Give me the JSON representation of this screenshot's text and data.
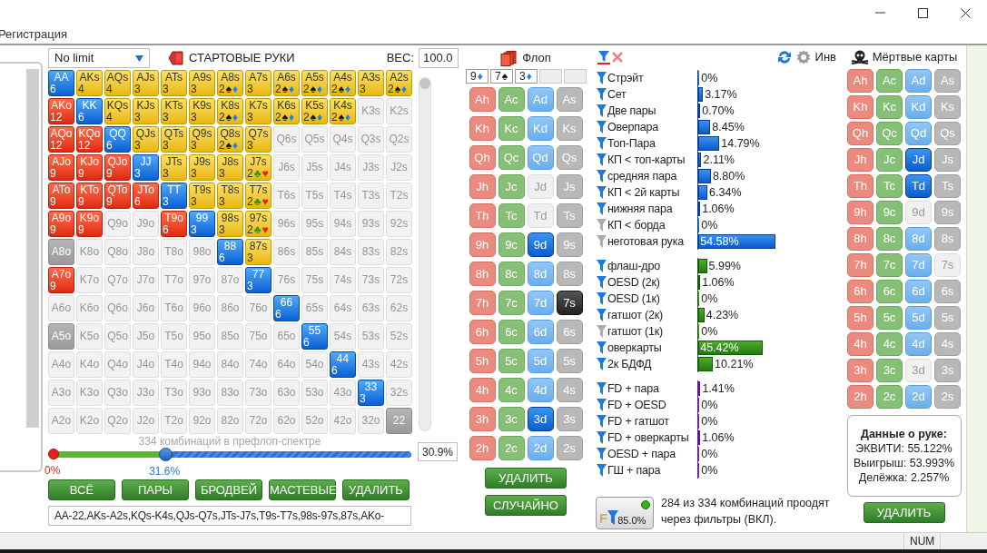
{
  "menu": [
    "Регистрация"
  ],
  "hand_range": {
    "game": "No limit",
    "title": "СТАРТОВЫЕ РУКИ",
    "weight_label": "ВЕС:",
    "weight": "100.0",
    "rows": [
      [
        {
          "label": "AA",
          "kind": "pair",
          "count": "6"
        },
        {
          "label": "AKs",
          "kind": "suited",
          "count": "4"
        },
        {
          "label": "AQs",
          "kind": "suited",
          "count": "4"
        },
        {
          "label": "AJs",
          "kind": "suited",
          "count": "3"
        },
        {
          "label": "ATs",
          "kind": "suited",
          "count": "3"
        },
        {
          "label": "A9s",
          "kind": "suited",
          "count": "3"
        },
        {
          "label": "A8s",
          "kind": "suited",
          "count": "2",
          "suits": [
            {
              "symbol": "♠",
              "color": "#111111"
            },
            {
              "symbol": "♦",
              "color": "#1784e8"
            }
          ]
        },
        {
          "label": "A7s",
          "kind": "suited",
          "count": "3"
        },
        {
          "label": "A6s",
          "kind": "suited",
          "count": "2",
          "suits": [
            {
              "symbol": "♠",
              "color": "#111111"
            },
            {
              "symbol": "♦",
              "color": "#1784e8"
            }
          ]
        },
        {
          "label": "A5s",
          "kind": "suited",
          "count": "2",
          "suits": [
            {
              "symbol": "♠",
              "color": "#111111"
            },
            {
              "symbol": "♦",
              "color": "#1784e8"
            }
          ]
        },
        {
          "label": "A4s",
          "kind": "suited",
          "count": "2",
          "suits": [
            {
              "symbol": "♠",
              "color": "#111111"
            },
            {
              "symbol": "♦",
              "color": "#1784e8"
            }
          ]
        },
        {
          "label": "A3s",
          "kind": "suited",
          "count": "3"
        },
        {
          "label": "A2s",
          "kind": "suited",
          "count": "2",
          "suits": [
            {
              "symbol": "♠",
              "color": "#111111"
            },
            {
              "symbol": "♦",
              "color": "#1784e8"
            }
          ]
        }
      ],
      [
        {
          "label": "AKo",
          "kind": "offsuit",
          "count": "12"
        },
        {
          "label": "KK",
          "kind": "pair",
          "count": "6"
        },
        {
          "label": "KQs",
          "kind": "suited",
          "count": "4"
        },
        {
          "label": "KJs",
          "kind": "suited",
          "count": "3"
        },
        {
          "label": "KTs",
          "kind": "suited",
          "count": "3"
        },
        {
          "label": "K9s",
          "kind": "suited",
          "count": "3"
        },
        {
          "label": "K8s",
          "kind": "suited",
          "count": "2",
          "suits": [
            {
              "symbol": "♠",
              "color": "#111111"
            },
            {
              "symbol": "♦",
              "color": "#1784e8"
            }
          ]
        },
        {
          "label": "K7s",
          "kind": "suited",
          "count": "3"
        },
        {
          "label": "K6s",
          "kind": "suited",
          "count": "2",
          "suits": [
            {
              "symbol": "♠",
              "color": "#111111"
            },
            {
              "symbol": "♦",
              "color": "#1784e8"
            }
          ]
        },
        {
          "label": "K5s",
          "kind": "suited",
          "count": "2",
          "suits": [
            {
              "symbol": "♠",
              "color": "#111111"
            },
            {
              "symbol": "♦",
              "color": "#1784e8"
            }
          ]
        },
        {
          "label": "K4s",
          "kind": "suited",
          "count": "2",
          "suits": [
            {
              "symbol": "♠",
              "color": "#111111"
            },
            {
              "symbol": "♦",
              "color": "#1784e8"
            }
          ]
        },
        {
          "label": "K3s",
          "kind": "empty"
        },
        {
          "label": "K2s",
          "kind": "empty"
        }
      ],
      [
        {
          "label": "AQo",
          "kind": "offsuit",
          "count": "12"
        },
        {
          "label": "KQo",
          "kind": "offsuit",
          "count": "12"
        },
        {
          "label": "QQ",
          "kind": "pair",
          "count": "6"
        },
        {
          "label": "QJs",
          "kind": "suited",
          "count": "3"
        },
        {
          "label": "QTs",
          "kind": "suited",
          "count": "3"
        },
        {
          "label": "Q9s",
          "kind": "suited",
          "count": "3"
        },
        {
          "label": "Q8s",
          "kind": "suited",
          "count": "2",
          "suits": [
            {
              "symbol": "♠",
              "color": "#111111"
            },
            {
              "symbol": "♦",
              "color": "#1784e8"
            }
          ]
        },
        {
          "label": "Q7s",
          "kind": "suited",
          "count": "3"
        },
        {
          "label": "Q6s",
          "kind": "empty"
        },
        {
          "label": "Q5s",
          "kind": "empty"
        },
        {
          "label": "Q4s",
          "kind": "empty"
        },
        {
          "label": "Q3s",
          "kind": "empty"
        },
        {
          "label": "Q2s",
          "kind": "empty"
        }
      ],
      [
        {
          "label": "AJo",
          "kind": "offsuit",
          "count": "9"
        },
        {
          "label": "KJo",
          "kind": "offsuit",
          "count": "9"
        },
        {
          "label": "QJo",
          "kind": "offsuit",
          "count": "9"
        },
        {
          "label": "JJ",
          "kind": "pair",
          "count": "3"
        },
        {
          "label": "JTs",
          "kind": "suited",
          "count": "3"
        },
        {
          "label": "J9s",
          "kind": "suited",
          "count": "3"
        },
        {
          "label": "J8s",
          "kind": "suited",
          "count": "3"
        },
        {
          "label": "J7s",
          "kind": "suited",
          "count": "2",
          "suits": [
            {
              "symbol": "♣",
              "color": "#2a9a1a"
            },
            {
              "symbol": "♥",
              "color": "#e8201a"
            }
          ]
        },
        {
          "label": "J6s",
          "kind": "empty"
        },
        {
          "label": "J5s",
          "kind": "empty"
        },
        {
          "label": "J4s",
          "kind": "empty"
        },
        {
          "label": "J3s",
          "kind": "empty"
        },
        {
          "label": "J2s",
          "kind": "empty"
        }
      ],
      [
        {
          "label": "ATo",
          "kind": "offsuit",
          "count": "9"
        },
        {
          "label": "KTo",
          "kind": "offsuit",
          "count": "9"
        },
        {
          "label": "QTo",
          "kind": "offsuit",
          "count": "9"
        },
        {
          "label": "JTo",
          "kind": "offsuit",
          "count": "6"
        },
        {
          "label": "TT",
          "kind": "pair",
          "count": "3"
        },
        {
          "label": "T9s",
          "kind": "suited",
          "count": "3"
        },
        {
          "label": "T8s",
          "kind": "suited",
          "count": "3"
        },
        {
          "label": "T7s",
          "kind": "suited",
          "count": "2",
          "suits": [
            {
              "symbol": "♣",
              "color": "#2a9a1a"
            },
            {
              "symbol": "♥",
              "color": "#e8201a"
            }
          ]
        },
        {
          "label": "T6s",
          "kind": "empty"
        },
        {
          "label": "T5s",
          "kind": "empty"
        },
        {
          "label": "T4s",
          "kind": "empty"
        },
        {
          "label": "T3s",
          "kind": "empty"
        },
        {
          "label": "T2s",
          "kind": "empty"
        }
      ],
      [
        {
          "label": "A9o",
          "kind": "offsuit",
          "count": "9"
        },
        {
          "label": "K9o",
          "kind": "offsuit",
          "count": "9"
        },
        {
          "label": "Q9o",
          "kind": "empty"
        },
        {
          "label": "J9o",
          "kind": "empty"
        },
        {
          "label": "T9o",
          "kind": "offsuit",
          "count": "6"
        },
        {
          "label": "99",
          "kind": "pair",
          "count": "3"
        },
        {
          "label": "98s",
          "kind": "suited",
          "count": "3"
        },
        {
          "label": "97s",
          "kind": "suited",
          "count": "2",
          "suits": [
            {
              "symbol": "♣",
              "color": "#2a9a1a"
            },
            {
              "symbol": "♥",
              "color": "#e8201a"
            }
          ]
        },
        {
          "label": "96s",
          "kind": "empty"
        },
        {
          "label": "95s",
          "kind": "empty"
        },
        {
          "label": "94s",
          "kind": "empty"
        },
        {
          "label": "93s",
          "kind": "empty"
        },
        {
          "label": "92s",
          "kind": "empty"
        }
      ],
      [
        {
          "label": "A8o",
          "kind": "muted"
        },
        {
          "label": "K8o",
          "kind": "empty"
        },
        {
          "label": "Q8o",
          "kind": "empty"
        },
        {
          "label": "J8o",
          "kind": "empty"
        },
        {
          "label": "T8o",
          "kind": "empty"
        },
        {
          "label": "98o",
          "kind": "empty"
        },
        {
          "label": "88",
          "kind": "pair",
          "count": "6"
        },
        {
          "label": "87s",
          "kind": "suited",
          "count": "3"
        },
        {
          "label": "86s",
          "kind": "empty"
        },
        {
          "label": "85s",
          "kind": "empty"
        },
        {
          "label": "84s",
          "kind": "empty"
        },
        {
          "label": "83s",
          "kind": "empty"
        },
        {
          "label": "82s",
          "kind": "empty"
        }
      ],
      [
        {
          "label": "A7o",
          "kind": "offsuit",
          "count": "9"
        },
        {
          "label": "K7o",
          "kind": "empty"
        },
        {
          "label": "Q7o",
          "kind": "empty"
        },
        {
          "label": "J7o",
          "kind": "empty"
        },
        {
          "label": "T7o",
          "kind": "empty"
        },
        {
          "label": "97o",
          "kind": "empty"
        },
        {
          "label": "87o",
          "kind": "empty"
        },
        {
          "label": "77",
          "kind": "pair",
          "count": "3"
        },
        {
          "label": "76s",
          "kind": "empty"
        },
        {
          "label": "75s",
          "kind": "empty"
        },
        {
          "label": "74s",
          "kind": "empty"
        },
        {
          "label": "73s",
          "kind": "empty"
        },
        {
          "label": "72s",
          "kind": "empty"
        }
      ],
      [
        {
          "label": "A6o",
          "kind": "empty"
        },
        {
          "label": "K6o",
          "kind": "empty"
        },
        {
          "label": "Q6o",
          "kind": "empty"
        },
        {
          "label": "J6o",
          "kind": "empty"
        },
        {
          "label": "T6o",
          "kind": "empty"
        },
        {
          "label": "96o",
          "kind": "empty"
        },
        {
          "label": "86o",
          "kind": "empty"
        },
        {
          "label": "76o",
          "kind": "empty"
        },
        {
          "label": "66",
          "kind": "pair",
          "count": "6"
        },
        {
          "label": "65s",
          "kind": "empty"
        },
        {
          "label": "64s",
          "kind": "empty"
        },
        {
          "label": "63s",
          "kind": "empty"
        },
        {
          "label": "62s",
          "kind": "empty"
        }
      ],
      [
        {
          "label": "A5o",
          "kind": "muted"
        },
        {
          "label": "K5o",
          "kind": "empty"
        },
        {
          "label": "Q5o",
          "kind": "empty"
        },
        {
          "label": "J5o",
          "kind": "empty"
        },
        {
          "label": "T5o",
          "kind": "empty"
        },
        {
          "label": "95o",
          "kind": "empty"
        },
        {
          "label": "85o",
          "kind": "empty"
        },
        {
          "label": "75o",
          "kind": "empty"
        },
        {
          "label": "65o",
          "kind": "empty"
        },
        {
          "label": "55",
          "kind": "pair",
          "count": "6"
        },
        {
          "label": "54s",
          "kind": "empty"
        },
        {
          "label": "53s",
          "kind": "empty"
        },
        {
          "label": "52s",
          "kind": "empty"
        }
      ],
      [
        {
          "label": "A4o",
          "kind": "empty"
        },
        {
          "label": "K4o",
          "kind": "empty"
        },
        {
          "label": "Q4o",
          "kind": "empty"
        },
        {
          "label": "J4o",
          "kind": "empty"
        },
        {
          "label": "T4o",
          "kind": "empty"
        },
        {
          "label": "94o",
          "kind": "empty"
        },
        {
          "label": "84o",
          "kind": "empty"
        },
        {
          "label": "74o",
          "kind": "empty"
        },
        {
          "label": "64o",
          "kind": "empty"
        },
        {
          "label": "54o",
          "kind": "empty"
        },
        {
          "label": "44",
          "kind": "pair",
          "count": "6"
        },
        {
          "label": "43s",
          "kind": "empty"
        },
        {
          "label": "42s",
          "kind": "empty"
        }
      ],
      [
        {
          "label": "A3o",
          "kind": "empty"
        },
        {
          "label": "K3o",
          "kind": "empty"
        },
        {
          "label": "Q3o",
          "kind": "empty"
        },
        {
          "label": "J3o",
          "kind": "empty"
        },
        {
          "label": "T3o",
          "kind": "empty"
        },
        {
          "label": "93o",
          "kind": "empty"
        },
        {
          "label": "83o",
          "kind": "empty"
        },
        {
          "label": "73o",
          "kind": "empty"
        },
        {
          "label": "63o",
          "kind": "empty"
        },
        {
          "label": "53o",
          "kind": "empty"
        },
        {
          "label": "43o",
          "kind": "empty"
        },
        {
          "label": "33",
          "kind": "pair",
          "count": "3"
        },
        {
          "label": "32s",
          "kind": "empty"
        }
      ],
      [
        {
          "label": "A2o",
          "kind": "empty"
        },
        {
          "label": "K2o",
          "kind": "empty"
        },
        {
          "label": "Q2o",
          "kind": "empty"
        },
        {
          "label": "J2o",
          "kind": "empty"
        },
        {
          "label": "T2o",
          "kind": "empty"
        },
        {
          "label": "92o",
          "kind": "empty"
        },
        {
          "label": "82o",
          "kind": "empty"
        },
        {
          "label": "72o",
          "kind": "empty"
        },
        {
          "label": "62o",
          "kind": "empty"
        },
        {
          "label": "52o",
          "kind": "empty"
        },
        {
          "label": "42o",
          "kind": "empty"
        },
        {
          "label": "32o",
          "kind": "empty"
        },
        {
          "label": "22",
          "kind": "muted"
        }
      ]
    ],
    "slider": {
      "caption": "334 комбинаций в префлоп-спектре",
      "min_label": "0%",
      "thumb_label": "31.6%",
      "level": 0.316,
      "percent": "30.9%"
    },
    "buttons": [
      "ВСЁ",
      "ПАРЫ",
      "БРОДВЕЙ",
      "МАСТЕВЫЕ",
      "УДАЛИТЬ"
    ],
    "range_text": "AA-22,AKs-A2s,KQs-K4s,QJs-Q7s,JTs-J7s,T9s-T7s,98s-97s,87s,AKo-"
  },
  "flop": {
    "title": "Флоп",
    "slots": [
      {
        "kind": "card",
        "rank": "9",
        "suit": "♦",
        "color": "#1784e8"
      },
      {
        "kind": "card",
        "rank": "7",
        "suit": "♠",
        "color": "#111111"
      },
      {
        "kind": "card",
        "rank": "3",
        "suit": "♦",
        "color": "#1784e8"
      },
      {
        "kind": "empty"
      },
      {
        "kind": "empty"
      }
    ],
    "cards": [
      [
        {
          "label": "Ah",
          "selected": false,
          "disabled": false
        },
        {
          "label": "Ac",
          "selected": false,
          "disabled": false
        },
        {
          "label": "Ad",
          "selected": false,
          "disabled": false
        },
        {
          "label": "As",
          "selected": false,
          "disabled": false
        }
      ],
      [
        {
          "label": "Kh",
          "selected": false,
          "disabled": false
        },
        {
          "label": "Kc",
          "selected": false,
          "disabled": false
        },
        {
          "label": "Kd",
          "selected": false,
          "disabled": false
        },
        {
          "label": "Ks",
          "selected": false,
          "disabled": false
        }
      ],
      [
        {
          "label": "Qh",
          "selected": false,
          "disabled": false
        },
        {
          "label": "Qc",
          "selected": false,
          "disabled": false
        },
        {
          "label": "Qd",
          "selected": false,
          "disabled": false
        },
        {
          "label": "Qs",
          "selected": false,
          "disabled": false
        }
      ],
      [
        {
          "label": "Jh",
          "selected": false,
          "disabled": false
        },
        {
          "label": "Jc",
          "selected": false,
          "disabled": false
        },
        {
          "label": "Jd",
          "selected": false,
          "disabled": true
        },
        {
          "label": "Js",
          "selected": false,
          "disabled": false
        }
      ],
      [
        {
          "label": "Th",
          "selected": false,
          "disabled": false
        },
        {
          "label": "Tc",
          "selected": false,
          "disabled": false
        },
        {
          "label": "Td",
          "selected": false,
          "disabled": true
        },
        {
          "label": "Ts",
          "selected": false,
          "disabled": false
        }
      ],
      [
        {
          "label": "9h",
          "selected": false,
          "disabled": false
        },
        {
          "label": "9c",
          "selected": false,
          "disabled": false
        },
        {
          "label": "9d",
          "selected": true,
          "disabled": false
        },
        {
          "label": "9s",
          "selected": false,
          "disabled": false
        }
      ],
      [
        {
          "label": "8h",
          "selected": false,
          "disabled": false
        },
        {
          "label": "8c",
          "selected": false,
          "disabled": false
        },
        {
          "label": "8d",
          "selected": false,
          "disabled": false
        },
        {
          "label": "8s",
          "selected": false,
          "disabled": false
        }
      ],
      [
        {
          "label": "7h",
          "selected": false,
          "disabled": false
        },
        {
          "label": "7c",
          "selected": false,
          "disabled": false
        },
        {
          "label": "7d",
          "selected": false,
          "disabled": false
        },
        {
          "label": "7s",
          "selected": true,
          "disabled": false
        }
      ],
      [
        {
          "label": "6h",
          "selected": false,
          "disabled": false
        },
        {
          "label": "6c",
          "selected": false,
          "disabled": false
        },
        {
          "label": "6d",
          "selected": false,
          "disabled": false
        },
        {
          "label": "6s",
          "selected": false,
          "disabled": false
        }
      ],
      [
        {
          "label": "5h",
          "selected": false,
          "disabled": false
        },
        {
          "label": "5c",
          "selected": false,
          "disabled": false
        },
        {
          "label": "5d",
          "selected": false,
          "disabled": false
        },
        {
          "label": "5s",
          "selected": false,
          "disabled": false
        }
      ],
      [
        {
          "label": "4h",
          "selected": false,
          "disabled": false
        },
        {
          "label": "4c",
          "selected": false,
          "disabled": false
        },
        {
          "label": "4d",
          "selected": false,
          "disabled": false
        },
        {
          "label": "4s",
          "selected": false,
          "disabled": false
        }
      ],
      [
        {
          "label": "3h",
          "selected": false,
          "disabled": false
        },
        {
          "label": "3c",
          "selected": false,
          "disabled": false
        },
        {
          "label": "3d",
          "selected": true,
          "disabled": false
        },
        {
          "label": "3s",
          "selected": false,
          "disabled": false
        }
      ],
      [
        {
          "label": "2h",
          "selected": false,
          "disabled": false
        },
        {
          "label": "2c",
          "selected": false,
          "disabled": false
        },
        {
          "label": "2d",
          "selected": false,
          "disabled": false
        },
        {
          "label": "2s",
          "selected": false,
          "disabled": false
        }
      ]
    ],
    "buttons": [
      "УДАЛИТЬ",
      "СЛУЧАЙНО"
    ]
  },
  "stats": {
    "toolbar_label": "Инв",
    "groups": [
      {
        "kind": "made",
        "rows": [
          {
            "label": "Стрэйт",
            "value": "0%",
            "level": 0,
            "active": true
          },
          {
            "label": "Сет",
            "value": "3.17%",
            "level": 0.0317,
            "active": true
          },
          {
            "label": "Две пары",
            "value": "0.70%",
            "level": 0.007,
            "active": true
          },
          {
            "label": "Оверпара",
            "value": "8.45%",
            "level": 0.0845,
            "active": true
          },
          {
            "label": "Топ-Пара",
            "value": "14.79%",
            "level": 0.1479,
            "active": true
          },
          {
            "label": "КП < топ-карты",
            "value": "2.11%",
            "level": 0.0211,
            "active": true
          },
          {
            "label": "средняя пара",
            "value": "8.80%",
            "level": 0.088,
            "active": true
          },
          {
            "label": "КП < 2й карты",
            "value": "6.34%",
            "level": 0.0634,
            "active": true
          },
          {
            "label": "нижняя пара",
            "value": "1.06%",
            "level": 0.0106,
            "active": true
          },
          {
            "label": "КП < борда",
            "value": "0%",
            "level": 0,
            "active": false
          },
          {
            "label": "неготовая рука",
            "value": "54.58%",
            "level": 0.5458,
            "active": false
          }
        ]
      },
      {
        "kind": "draw",
        "rows": [
          {
            "label": "флаш-дро",
            "value": "5.99%",
            "level": 0.0599,
            "active": true
          },
          {
            "label": "OESD (2к)",
            "value": "1.06%",
            "level": 0.0106,
            "active": true
          },
          {
            "label": "OESD (1к)",
            "value": "0%",
            "level": 0,
            "active": true
          },
          {
            "label": "гатшот (2к)",
            "value": "4.23%",
            "level": 0.0423,
            "active": true
          },
          {
            "label": "гатшот (1к)",
            "value": "0%",
            "level": 0,
            "active": false
          },
          {
            "label": "оверкарты",
            "value": "45.42%",
            "level": 0.4542,
            "active": true
          },
          {
            "label": "2к БДФД",
            "value": "10.21%",
            "level": 0.1021,
            "active": true
          }
        ]
      },
      {
        "kind": "combo",
        "rows": [
          {
            "label": "FD + пара",
            "value": "1.41%",
            "level": 0.0141,
            "active": true
          },
          {
            "label": "FD + OESD",
            "value": "0%",
            "level": 0,
            "active": true
          },
          {
            "label": "FD + гатшот",
            "value": "0%",
            "level": 0,
            "active": true
          },
          {
            "label": "FD + оверкарты",
            "value": "1.06%",
            "level": 0.0106,
            "active": true
          },
          {
            "label": "OESD + пара",
            "value": "0%",
            "level": 0,
            "active": true
          },
          {
            "label": "ГШ + пара",
            "value": "0%",
            "level": 0,
            "active": true
          }
        ]
      }
    ],
    "filter": {
      "letter": "F",
      "percent": "85.0%",
      "on": true,
      "summary": "284 из 334 комбинаций проодят через фильтры (ВКЛ)."
    }
  },
  "dead_cards": {
    "title": "Мёртвые карты",
    "cards": [
      [
        {
          "label": "Ah",
          "selected": false,
          "disabled": false
        },
        {
          "label": "Ac",
          "selected": false,
          "disabled": false
        },
        {
          "label": "Ad",
          "selected": false,
          "disabled": false
        },
        {
          "label": "As",
          "selected": false,
          "disabled": false
        }
      ],
      [
        {
          "label": "Kh",
          "selected": false,
          "disabled": false
        },
        {
          "label": "Kc",
          "selected": false,
          "disabled": false
        },
        {
          "label": "Kd",
          "selected": false,
          "disabled": false
        },
        {
          "label": "Ks",
          "selected": false,
          "disabled": false
        }
      ],
      [
        {
          "label": "Qh",
          "selected": false,
          "disabled": false
        },
        {
          "label": "Qc",
          "selected": false,
          "disabled": false
        },
        {
          "label": "Qd",
          "selected": false,
          "disabled": false
        },
        {
          "label": "Qs",
          "selected": false,
          "disabled": false
        }
      ],
      [
        {
          "label": "Jh",
          "selected": false,
          "disabled": false
        },
        {
          "label": "Jc",
          "selected": false,
          "disabled": false
        },
        {
          "label": "Jd",
          "selected": true,
          "disabled": false
        },
        {
          "label": "Js",
          "selected": false,
          "disabled": false
        }
      ],
      [
        {
          "label": "Th",
          "selected": false,
          "disabled": false
        },
        {
          "label": "Tc",
          "selected": false,
          "disabled": false
        },
        {
          "label": "Td",
          "selected": true,
          "disabled": false
        },
        {
          "label": "Ts",
          "selected": false,
          "disabled": false
        }
      ],
      [
        {
          "label": "9h",
          "selected": false,
          "disabled": false
        },
        {
          "label": "9c",
          "selected": false,
          "disabled": false
        },
        {
          "label": "9d",
          "selected": false,
          "disabled": true
        },
        {
          "label": "9s",
          "selected": false,
          "disabled": false
        }
      ],
      [
        {
          "label": "8h",
          "selected": false,
          "disabled": false
        },
        {
          "label": "8c",
          "selected": false,
          "disabled": false
        },
        {
          "label": "8d",
          "selected": false,
          "disabled": false
        },
        {
          "label": "8s",
          "selected": false,
          "disabled": false
        }
      ],
      [
        {
          "label": "7h",
          "selected": false,
          "disabled": false
        },
        {
          "label": "7c",
          "selected": false,
          "disabled": false
        },
        {
          "label": "7d",
          "selected": false,
          "disabled": false
        },
        {
          "label": "7s",
          "selected": false,
          "disabled": true
        }
      ],
      [
        {
          "label": "6h",
          "selected": false,
          "disabled": false
        },
        {
          "label": "6c",
          "selected": false,
          "disabled": false
        },
        {
          "label": "6d",
          "selected": false,
          "disabled": false
        },
        {
          "label": "6s",
          "selected": false,
          "disabled": false
        }
      ],
      [
        {
          "label": "5h",
          "selected": false,
          "disabled": false
        },
        {
          "label": "5c",
          "selected": false,
          "disabled": false
        },
        {
          "label": "5d",
          "selected": false,
          "disabled": false
        },
        {
          "label": "5s",
          "selected": false,
          "disabled": false
        }
      ],
      [
        {
          "label": "4h",
          "selected": false,
          "disabled": false
        },
        {
          "label": "4c",
          "selected": false,
          "disabled": false
        },
        {
          "label": "4d",
          "selected": false,
          "disabled": false
        },
        {
          "label": "4s",
          "selected": false,
          "disabled": false
        }
      ],
      [
        {
          "label": "3h",
          "selected": false,
          "disabled": false
        },
        {
          "label": "3c",
          "selected": false,
          "disabled": false
        },
        {
          "label": "3d",
          "selected": false,
          "disabled": true
        },
        {
          "label": "3s",
          "selected": false,
          "disabled": false
        }
      ],
      [
        {
          "label": "2h",
          "selected": false,
          "disabled": false
        },
        {
          "label": "2c",
          "selected": false,
          "disabled": false
        },
        {
          "label": "2d",
          "selected": false,
          "disabled": false
        },
        {
          "label": "2s",
          "selected": false,
          "disabled": false
        }
      ]
    ],
    "info": {
      "title": "Данные о руке:",
      "lines": [
        "ЭКВИТИ: 55.122%",
        "Выигрыш: 53.993%",
        "Делёжка: 2.257%"
      ]
    },
    "button": "УДАЛИТЬ"
  },
  "status_bar": {
    "indicators": [
      "NUM"
    ]
  }
}
